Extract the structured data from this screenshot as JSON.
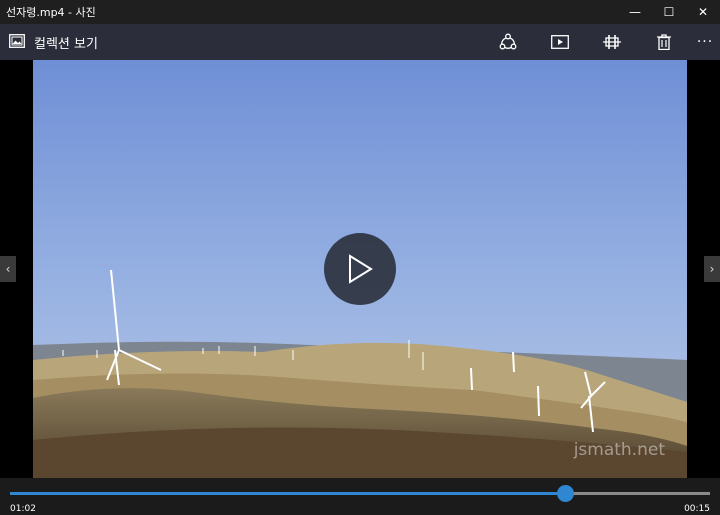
{
  "window": {
    "title": "선자령.mp4 - 사진",
    "buttons": {
      "minimize": "—",
      "maximize": "☐",
      "close": "✕"
    }
  },
  "toolbar": {
    "collection_label": "컬렉션 보기",
    "more_label": "···",
    "icons": [
      "collection-icon",
      "share-icon",
      "slideshow-icon",
      "trim-icon",
      "delete-icon"
    ]
  },
  "viewer": {
    "watermark": "jsmath.net",
    "nav_prev": "‹",
    "nav_next": "›"
  },
  "playback": {
    "current_time": "01:02",
    "remaining_time": "00:15",
    "progress": 0.793
  },
  "colors": {
    "accent": "#2f86d1",
    "toolbar_bg": "#2b2d3a",
    "titlebar_bg": "#1f1f1f"
  }
}
